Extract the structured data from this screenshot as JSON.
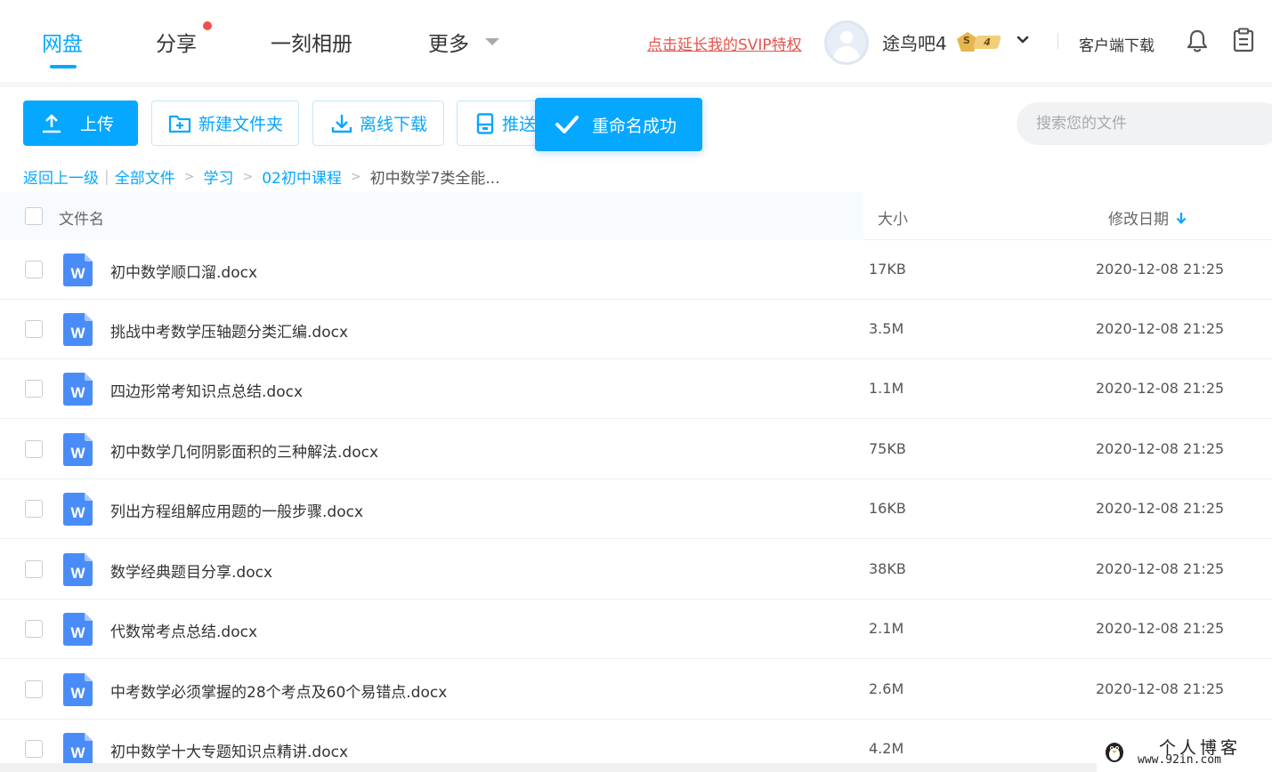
{
  "nav": {
    "tabs": [
      {
        "label": "网盘"
      },
      {
        "label": "分享"
      },
      {
        "label": "一刻相册"
      },
      {
        "label": "更多"
      }
    ],
    "svip_link": "点击延长我的SVIP特权",
    "username": "途鸟吧4",
    "badge_level": "4",
    "badge_letter": "S",
    "client_download": "客户端下载"
  },
  "toolbar": {
    "upload": "上传",
    "new_folder": "新建文件夹",
    "offline_download": "离线下载",
    "push": "推送",
    "toast": "重命名成功",
    "search_placeholder": "搜索您的文件"
  },
  "breadcrumb": {
    "back": "返回上一级",
    "all_files": "全部文件",
    "level1": "学习",
    "level2": "02初中课程",
    "current": "初中数学7类全能..."
  },
  "table": {
    "headers": {
      "name": "文件名",
      "size": "大小",
      "date": "修改日期"
    },
    "rows": [
      {
        "name": "初中数学顺口溜.docx",
        "size": "17KB",
        "date": "2020-12-08 21:25"
      },
      {
        "name": "挑战中考数学压轴题分类汇编.docx",
        "size": "3.5M",
        "date": "2020-12-08 21:25"
      },
      {
        "name": "四边形常考知识点总结.docx",
        "size": "1.1M",
        "date": "2020-12-08 21:25"
      },
      {
        "name": "初中数学几何阴影面积的三种解法.docx",
        "size": "75KB",
        "date": "2020-12-08 21:25"
      },
      {
        "name": "列出方程组解应用题的一般步骤.docx",
        "size": "16KB",
        "date": "2020-12-08 21:25"
      },
      {
        "name": "数学经典题目分享.docx",
        "size": "38KB",
        "date": "2020-12-08 21:25"
      },
      {
        "name": "代数常考点总结.docx",
        "size": "2.1M",
        "date": "2020-12-08 21:25"
      },
      {
        "name": "中考数学必须掌握的28个考点及60个易错点.docx",
        "size": "2.6M",
        "date": "2020-12-08 21:25"
      },
      {
        "name": "初中数学十大专题知识点精讲.docx",
        "size": "4.2M",
        "date": ""
      }
    ]
  },
  "watermark": {
    "title": "个人博客",
    "url": "www.92in.com"
  },
  "icons": {
    "doc": "word-doc-icon",
    "upload": "upload-icon",
    "new_folder": "new-folder-icon",
    "download": "download-icon",
    "push": "push-device-icon",
    "check": "check-icon",
    "bell": "bell-icon",
    "clipboard": "clipboard-icon"
  },
  "colors": {
    "accent": "#06a7ff",
    "svip_link": "#e4544d",
    "doc_icon": "#4a8cf7",
    "notify_dot": "#f0524a"
  }
}
